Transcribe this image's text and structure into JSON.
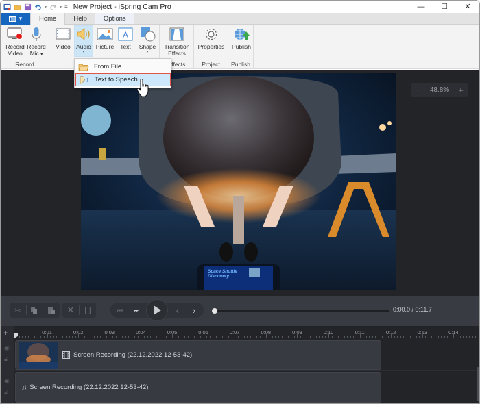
{
  "window": {
    "title": "New Project - iSpring Cam Pro",
    "controls": {
      "minimize": "—",
      "maximize": "☐",
      "close": "✕"
    }
  },
  "quick_access": {
    "icons": [
      "app-icon",
      "open-folder-icon",
      "save-icon",
      "undo-icon",
      "redo-icon",
      "customize-icon"
    ]
  },
  "tabs": [
    {
      "label": "Home",
      "active": true
    },
    {
      "label": "Help",
      "active": false
    },
    {
      "label": "Options",
      "active": false
    }
  ],
  "ribbon": {
    "groups": [
      {
        "label": "Record",
        "buttons": [
          {
            "label1": "Record",
            "label2": "Video"
          },
          {
            "label1": "Record",
            "label2": "Mic",
            "dropdown": true
          }
        ]
      },
      {
        "label": "",
        "buttons": [
          {
            "label1": "Video"
          },
          {
            "label1": "Audio",
            "dropdown": true,
            "pressed": true
          },
          {
            "label1": "Picture"
          },
          {
            "label1": "Text"
          },
          {
            "label1": "Shape",
            "dropdown": true
          }
        ]
      },
      {
        "label": "Effects",
        "buttons": [
          {
            "label1": "Transition",
            "label2": "Effects"
          }
        ]
      },
      {
        "label": "Project",
        "buttons": [
          {
            "label1": "Properties"
          }
        ]
      },
      {
        "label": "Publish",
        "buttons": [
          {
            "label1": "Publish"
          }
        ]
      }
    ]
  },
  "audio_menu": {
    "items": [
      {
        "label": "From File...",
        "icon": "folder-icon",
        "selected": false
      },
      {
        "label": "Text to Speech",
        "icon": "speaking-head-icon",
        "selected": true
      }
    ]
  },
  "preview": {
    "zoom_level": "48.8%",
    "zoom_out": "−",
    "zoom_in": "+",
    "sign_text": [
      "Space Shuttle",
      "Discovery"
    ]
  },
  "player": {
    "current_time": "0:00.0",
    "total_time": "0:11.7",
    "time_display": "0:00.0 / 0:11.7",
    "progress": 0
  },
  "timeline": {
    "ticks": [
      "0:01",
      "0:02",
      "0:03",
      "0:04",
      "0:05",
      "0:06",
      "0:07",
      "0:08",
      "0:09",
      "0:10",
      "0:11",
      "0:12",
      "0:13",
      "0:14"
    ],
    "tracks": [
      {
        "type": "video",
        "label": "Screen Recording (22.12.2022 12-53-42)"
      },
      {
        "type": "audio",
        "label": "Screen Recording (22.12.2022 12-53-42)"
      }
    ],
    "clip_duration_seconds": 11.7
  },
  "colors": {
    "accent": "#1666c0",
    "selection_border": "#e0564a",
    "selection_fill": "#cde8fa",
    "dark_bg": "#232428",
    "panel_bg": "#383b42"
  }
}
